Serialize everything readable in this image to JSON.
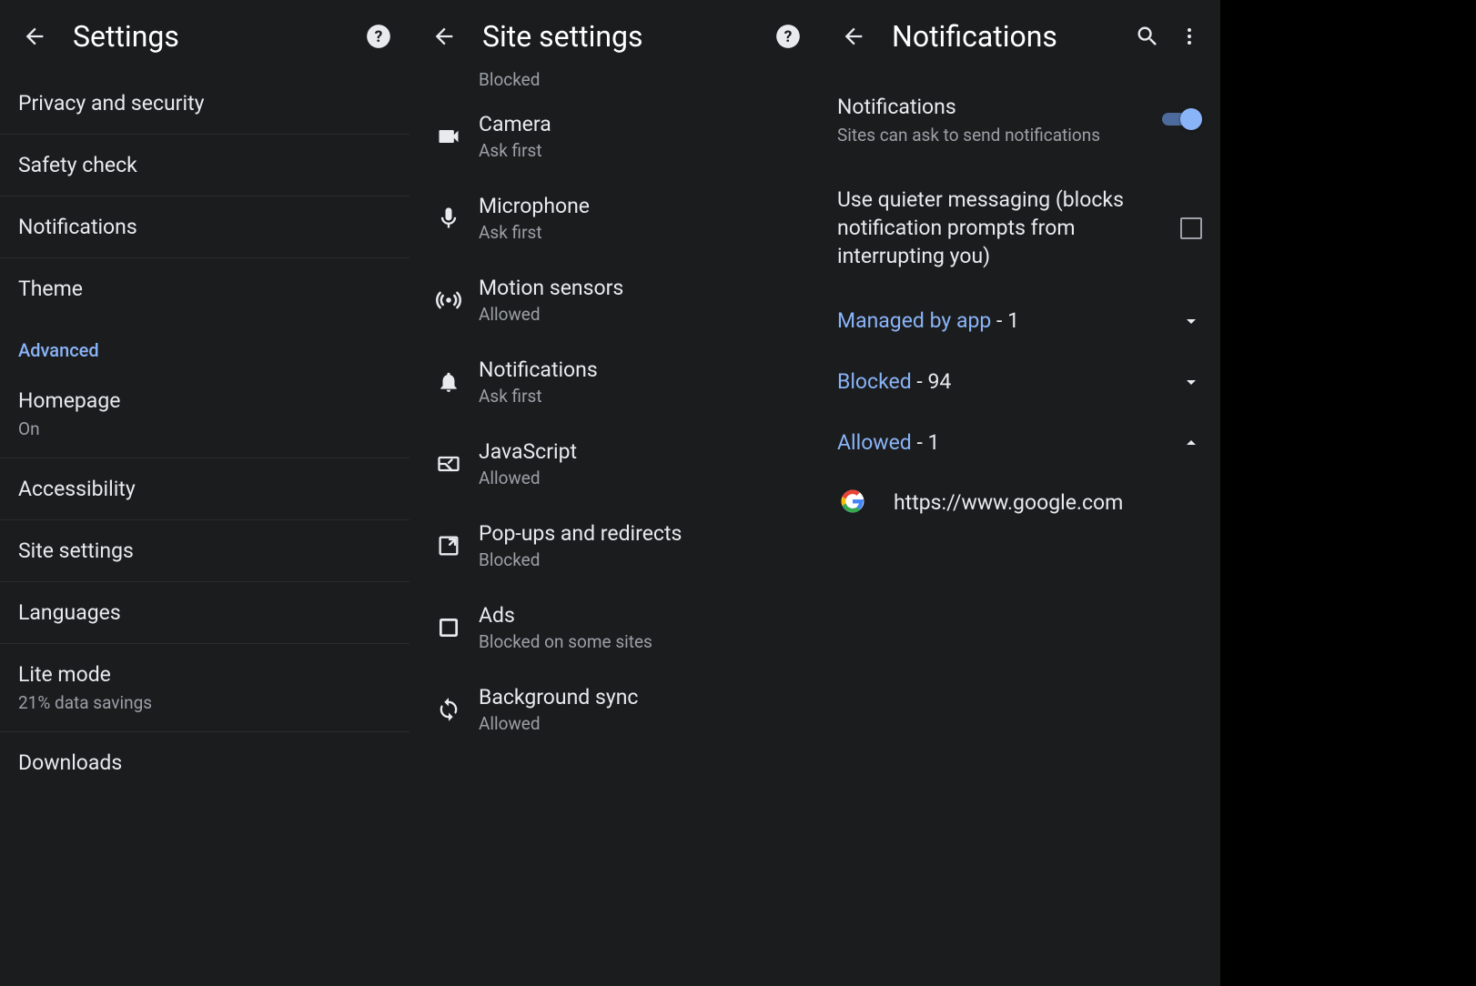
{
  "panel1": {
    "title": "Settings",
    "rows": [
      {
        "label": "Privacy and security"
      },
      {
        "label": "Safety check"
      },
      {
        "label": "Notifications"
      },
      {
        "label": "Theme"
      }
    ],
    "advanced_label": "Advanced",
    "advanced_rows": [
      {
        "label": "Homepage",
        "sub": "On"
      },
      {
        "label": "Accessibility"
      },
      {
        "label": "Site settings"
      },
      {
        "label": "Languages"
      },
      {
        "label": "Lite mode",
        "sub": "21% data savings"
      },
      {
        "label": "Downloads"
      }
    ]
  },
  "panel2": {
    "title": "Site settings",
    "truncated_sub": "Blocked",
    "rows": [
      {
        "icon": "camera",
        "label": "Camera",
        "sub": "Ask first"
      },
      {
        "icon": "microphone",
        "label": "Microphone",
        "sub": "Ask first"
      },
      {
        "icon": "motion",
        "label": "Motion sensors",
        "sub": "Allowed"
      },
      {
        "icon": "bell",
        "label": "Notifications",
        "sub": "Ask first"
      },
      {
        "icon": "js",
        "label": "JavaScript",
        "sub": "Allowed"
      },
      {
        "icon": "popup",
        "label": "Pop-ups and redirects",
        "sub": "Blocked"
      },
      {
        "icon": "ads",
        "label": "Ads",
        "sub": "Blocked on some sites"
      },
      {
        "icon": "sync",
        "label": "Background sync",
        "sub": "Allowed"
      }
    ]
  },
  "panel3": {
    "title": "Notifications",
    "main_toggle": {
      "label": "Notifications",
      "sub": "Sites can ask to send notifications",
      "on": true
    },
    "quieter": {
      "label": "Use quieter messaging (blocks notification prompts from interrupting you)",
      "checked": false
    },
    "categories": [
      {
        "label": "Managed by app",
        "count": "1",
        "expanded": false
      },
      {
        "label": "Blocked",
        "count": "94",
        "expanded": false
      },
      {
        "label": "Allowed",
        "count": "1",
        "expanded": true
      }
    ],
    "allowed_sites": [
      {
        "icon": "google",
        "url": "https://www.google.com"
      }
    ]
  }
}
